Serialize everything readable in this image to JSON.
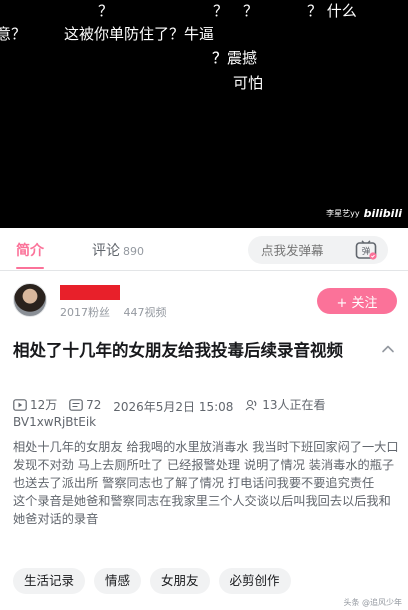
{
  "video": {
    "danmaku": [
      "？",
      "？",
      "？",
      "？ 什么",
      "意？",
      "这被你单防住了？牛逼",
      "？",
      "？震撼",
      "可怕"
    ],
    "watermark_user": "李星艺yy",
    "watermark_brand": "bilibili"
  },
  "tabs": {
    "intro": "简介",
    "comments": "评论",
    "comments_count": "890",
    "danmu_placeholder": "点我发弹幕",
    "danmu_button_icon": "弹"
  },
  "uploader": {
    "followers": "2017粉丝",
    "videos": "447视频",
    "follow_label": "+ 关注"
  },
  "title": "相处了十几年的女朋友给我投毒后续录音视频",
  "meta": {
    "plays": "12万",
    "danmaku_count": "72",
    "date": "2026年5月2日 15:08",
    "watching": "13人正在看",
    "bvid": "BV1xwRjBtEik"
  },
  "description": [
    "相处十几年的女朋友 给我喝的水里放消毒水 我当时下班回家闷了一大口发现不对劲 马上去厕所吐了 已经报警处理 说明了情况 装消毒水的瓶子也送去了派出所 警察同志也了解了情况 打电话问我要不要追究责任",
    "这个录音是她爸和警察同志在我家里三个人交谈以后叫我回去以后我和她爸对话的录音"
  ],
  "tags": [
    "生活记录",
    "情感",
    "女朋友",
    "必剪创作"
  ],
  "corner_mark": "头条 @追风少年",
  "colors": {
    "accent": "#fb7299",
    "redaction": "#e8202a"
  },
  "icons": [
    "play-count-icon",
    "danmaku-count-icon",
    "watching-icon",
    "collapse-chevron-icon",
    "danmu-toggle-icon"
  ]
}
